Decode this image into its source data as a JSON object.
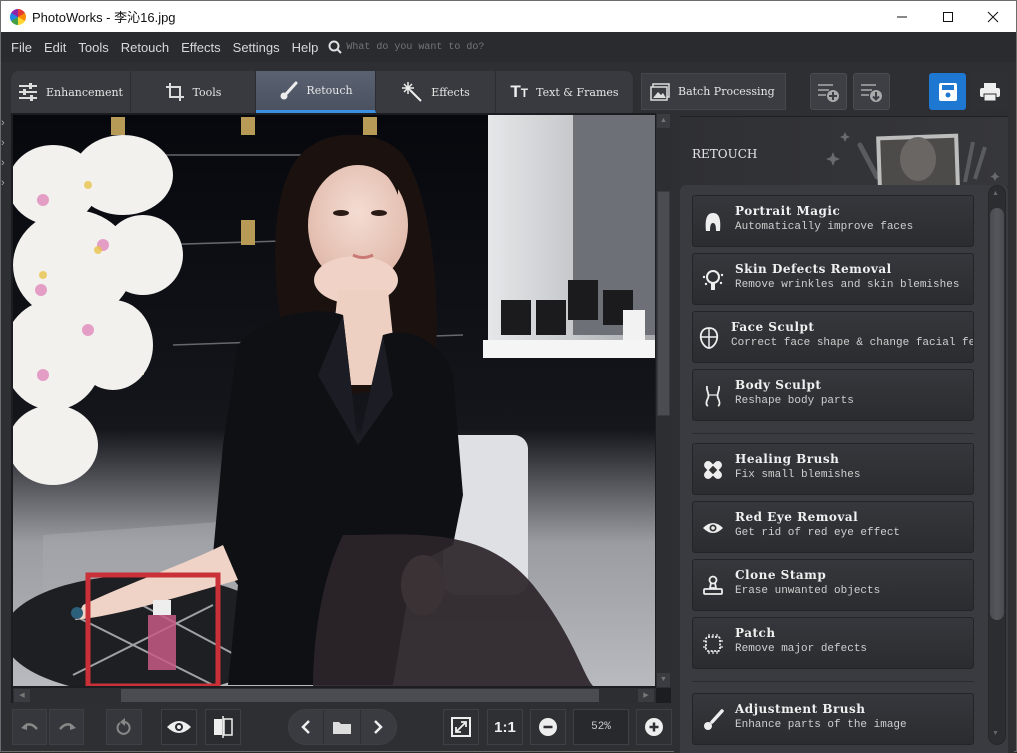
{
  "window": {
    "title": "PhotoWorks - 李沁16.jpg",
    "minimize_label": "—",
    "maximize_label": "☐",
    "close_label": "✕"
  },
  "menu": {
    "items": [
      "File",
      "Edit",
      "Tools",
      "Retouch",
      "Effects",
      "Settings",
      "Help"
    ],
    "search_placeholder": "What do you want to do?"
  },
  "tabs": [
    {
      "label": "Enhancement",
      "icon": "sliders-icon",
      "active": false
    },
    {
      "label": "Tools",
      "icon": "crop-icon",
      "active": false
    },
    {
      "label": "Retouch",
      "icon": "brush-icon",
      "active": true
    },
    {
      "label": "Effects",
      "icon": "magic-wand-icon",
      "active": false
    },
    {
      "label": "Text & Frames",
      "icon": "text-icon",
      "active": false
    }
  ],
  "toolbar": {
    "batch_label": "Batch Processing",
    "add_preset_icon": "preset-add-icon",
    "download_preset_icon": "preset-download-icon",
    "save_icon": "save-icon",
    "print_icon": "print-icon",
    "accent_color": "#1e78d2"
  },
  "bottom": {
    "zoom_value": "52%",
    "one_to_one_label": "1:1"
  },
  "panel": {
    "title": "RETOUCH",
    "tools": [
      {
        "name": "Portrait Magic",
        "desc": "Automatically improve faces",
        "icon": "portrait-magic-icon"
      },
      {
        "name": "Skin Defects Removal",
        "desc": "Remove wrinkles and skin blemishes",
        "icon": "skin-defects-icon"
      },
      {
        "name": "Face Sculpt",
        "desc": "Correct face shape & change facial featu",
        "icon": "face-sculpt-icon"
      },
      {
        "name": "Body Sculpt",
        "desc": "Reshape body parts",
        "icon": "body-sculpt-icon"
      },
      {
        "name": "Healing Brush",
        "desc": "Fix small blemishes",
        "icon": "bandage-icon"
      },
      {
        "name": "Red Eye Removal",
        "desc": "Get rid of red eye effect",
        "icon": "eye-icon"
      },
      {
        "name": "Clone Stamp",
        "desc": "Erase unwanted objects",
        "icon": "stamp-icon"
      },
      {
        "name": "Patch",
        "desc": "Remove major defects",
        "icon": "patch-icon"
      },
      {
        "name": "Adjustment Brush",
        "desc": "Enhance parts of the image",
        "icon": "brush-icon"
      }
    ]
  }
}
